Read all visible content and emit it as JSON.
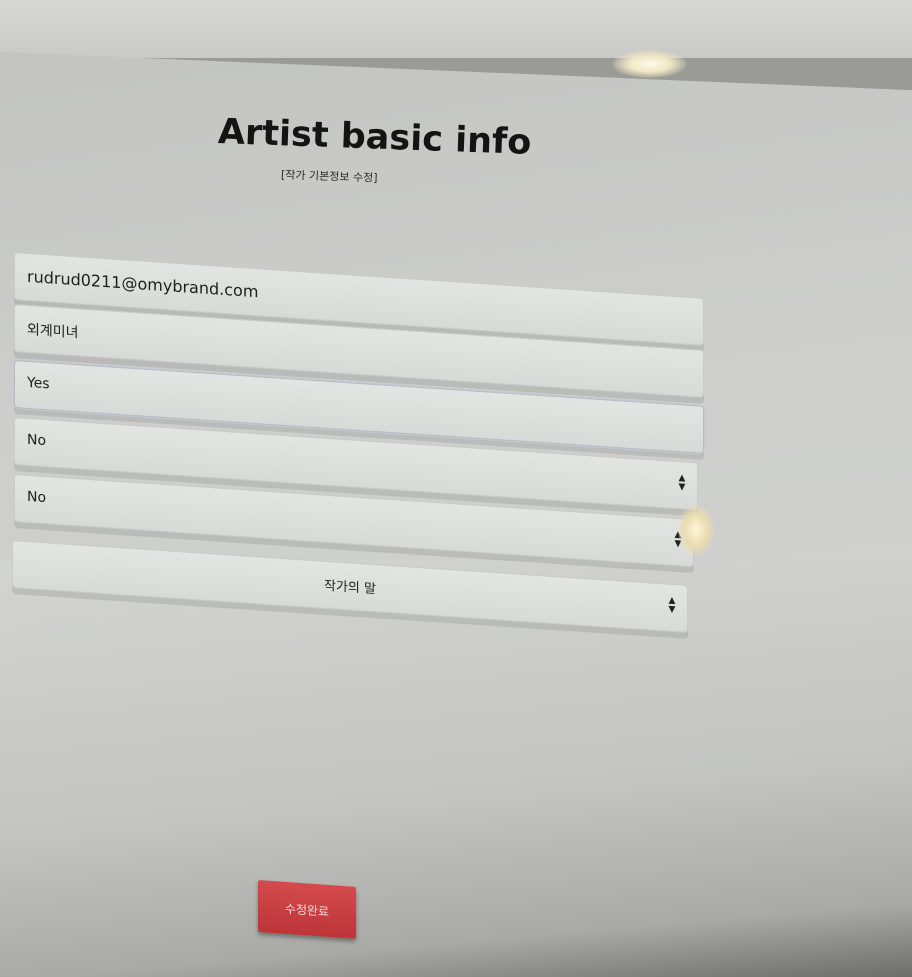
{
  "page": {
    "title": "Artist basic info",
    "subtitle": "[작가 기본정보 수정]"
  },
  "form": {
    "email": "rudrud0211@omybrand.com",
    "artist_name": "외계미녀",
    "field_yes": "Yes",
    "select_1": "No",
    "select_2": "No",
    "artist_message": "작가의 말"
  },
  "buttons": {
    "submit_label": "수정완료"
  },
  "icons": {
    "select_arrows": "sort-arrows-icon"
  },
  "colors": {
    "submit_button": "#c83f42",
    "input_background": "#dfe1df",
    "panel_background": "#c9cac6"
  }
}
